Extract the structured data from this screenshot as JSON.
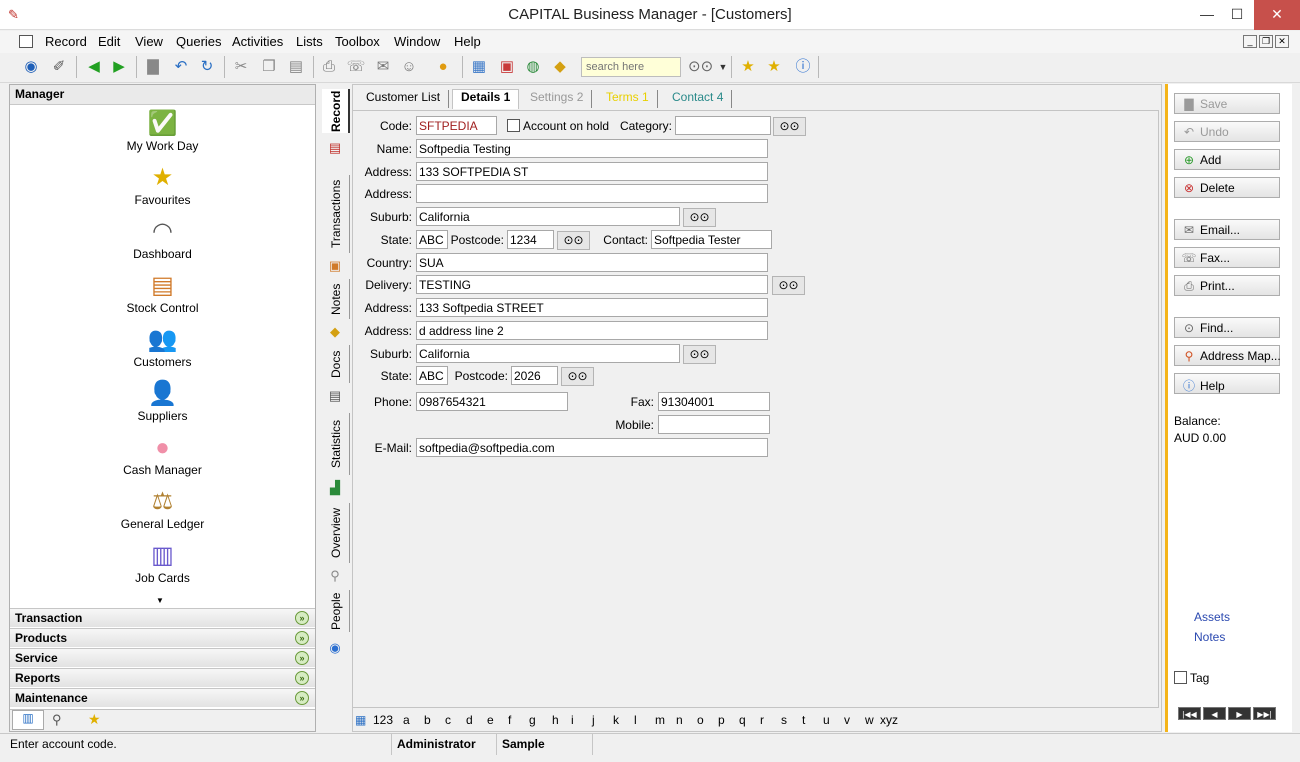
{
  "window": {
    "title": "CAPITAL Business Manager - [Customers]",
    "minimize": "—",
    "maximize": "☐",
    "close": "✕"
  },
  "menu": [
    "Record",
    "Edit",
    "View",
    "Queries",
    "Activities",
    "Lists",
    "Toolbox",
    "Window",
    "Help"
  ],
  "toolbar": {
    "search_placeholder": "search here"
  },
  "manager": {
    "header": "Manager",
    "items": [
      "My Work Day",
      "Favourites",
      "Dashboard",
      "Stock Control",
      "Customers",
      "Suppliers",
      "Cash Manager",
      "General Ledger",
      "Job Cards"
    ],
    "sections": [
      "Transaction",
      "Products",
      "Service",
      "Reports",
      "Maintenance"
    ]
  },
  "side_tabs": [
    "Record",
    "Transactions",
    "Notes",
    "Docs",
    "Statistics",
    "Overview",
    "People"
  ],
  "tabs": [
    {
      "label": "Customer List",
      "state": "normal"
    },
    {
      "label": "Details 1",
      "state": "active"
    },
    {
      "label": "Settings 2",
      "state": "disabled"
    },
    {
      "label": "Terms 1",
      "state": "yellow"
    },
    {
      "label": "Contact 4",
      "state": "teal"
    }
  ],
  "form": {
    "code_label": "Code:",
    "code": "SFTPEDIA",
    "on_hold_label": "Account on hold",
    "category_label": "Category:",
    "category": "",
    "name_label": "Name:",
    "name": "Softpedia Testing",
    "address1_label": "Address:",
    "address1": "133 SOFTPEDIA ST",
    "address2_label": "Address:",
    "address2": "",
    "suburb_label": "Suburb:",
    "suburb": "California",
    "state_label": "State:",
    "state": "ABC",
    "postcode_label": "Postcode:",
    "postcode": "1234",
    "contact_label": "Contact:",
    "contact": "Softpedia Tester",
    "country_label": "Country:",
    "country": "SUA",
    "delivery_label": "Delivery:",
    "delivery": "TESTING",
    "daddress1_label": "Address:",
    "daddress1": "133 Softpedia STREET",
    "daddress2_label": "Address:",
    "daddress2": "d address line 2",
    "dsuburb_label": "Suburb:",
    "dsuburb": "California",
    "dstate_label": "State:",
    "dstate": "ABC",
    "dpostcode_label": "Postcode:",
    "dpostcode": "2026",
    "phone_label": "Phone:",
    "phone": "0987654321",
    "fax_label": "Fax:",
    "fax": "91304001",
    "mobile_label": "Mobile:",
    "mobile": "",
    "email_label": "E-Mail:",
    "email": "softpedia@softpedia.com"
  },
  "alphabet": [
    "123",
    "a",
    "b",
    "c",
    "d",
    "e",
    "f",
    "g",
    "h",
    "i",
    "j",
    "k",
    "l",
    "m",
    "n",
    "o",
    "p",
    "q",
    "r",
    "s",
    "t",
    "u",
    "v",
    "w",
    "xyz"
  ],
  "actions": {
    "save": "Save",
    "undo": "Undo",
    "add": "Add",
    "delete": "Delete",
    "email": "Email...",
    "fax": "Fax...",
    "print": "Print...",
    "find": "Find...",
    "address_map": "Address Map...",
    "help": "Help"
  },
  "balance": {
    "label": "Balance:",
    "value": "AUD 0.00"
  },
  "links": [
    "Assets",
    "Notes"
  ],
  "tag_label": "Tag",
  "status": {
    "message": "Enter account code.",
    "user": "Administrator",
    "company": "Sample"
  },
  "colors": {
    "accent": "#f4b41a",
    "link": "#2b49b0",
    "close": "#c7504b"
  }
}
